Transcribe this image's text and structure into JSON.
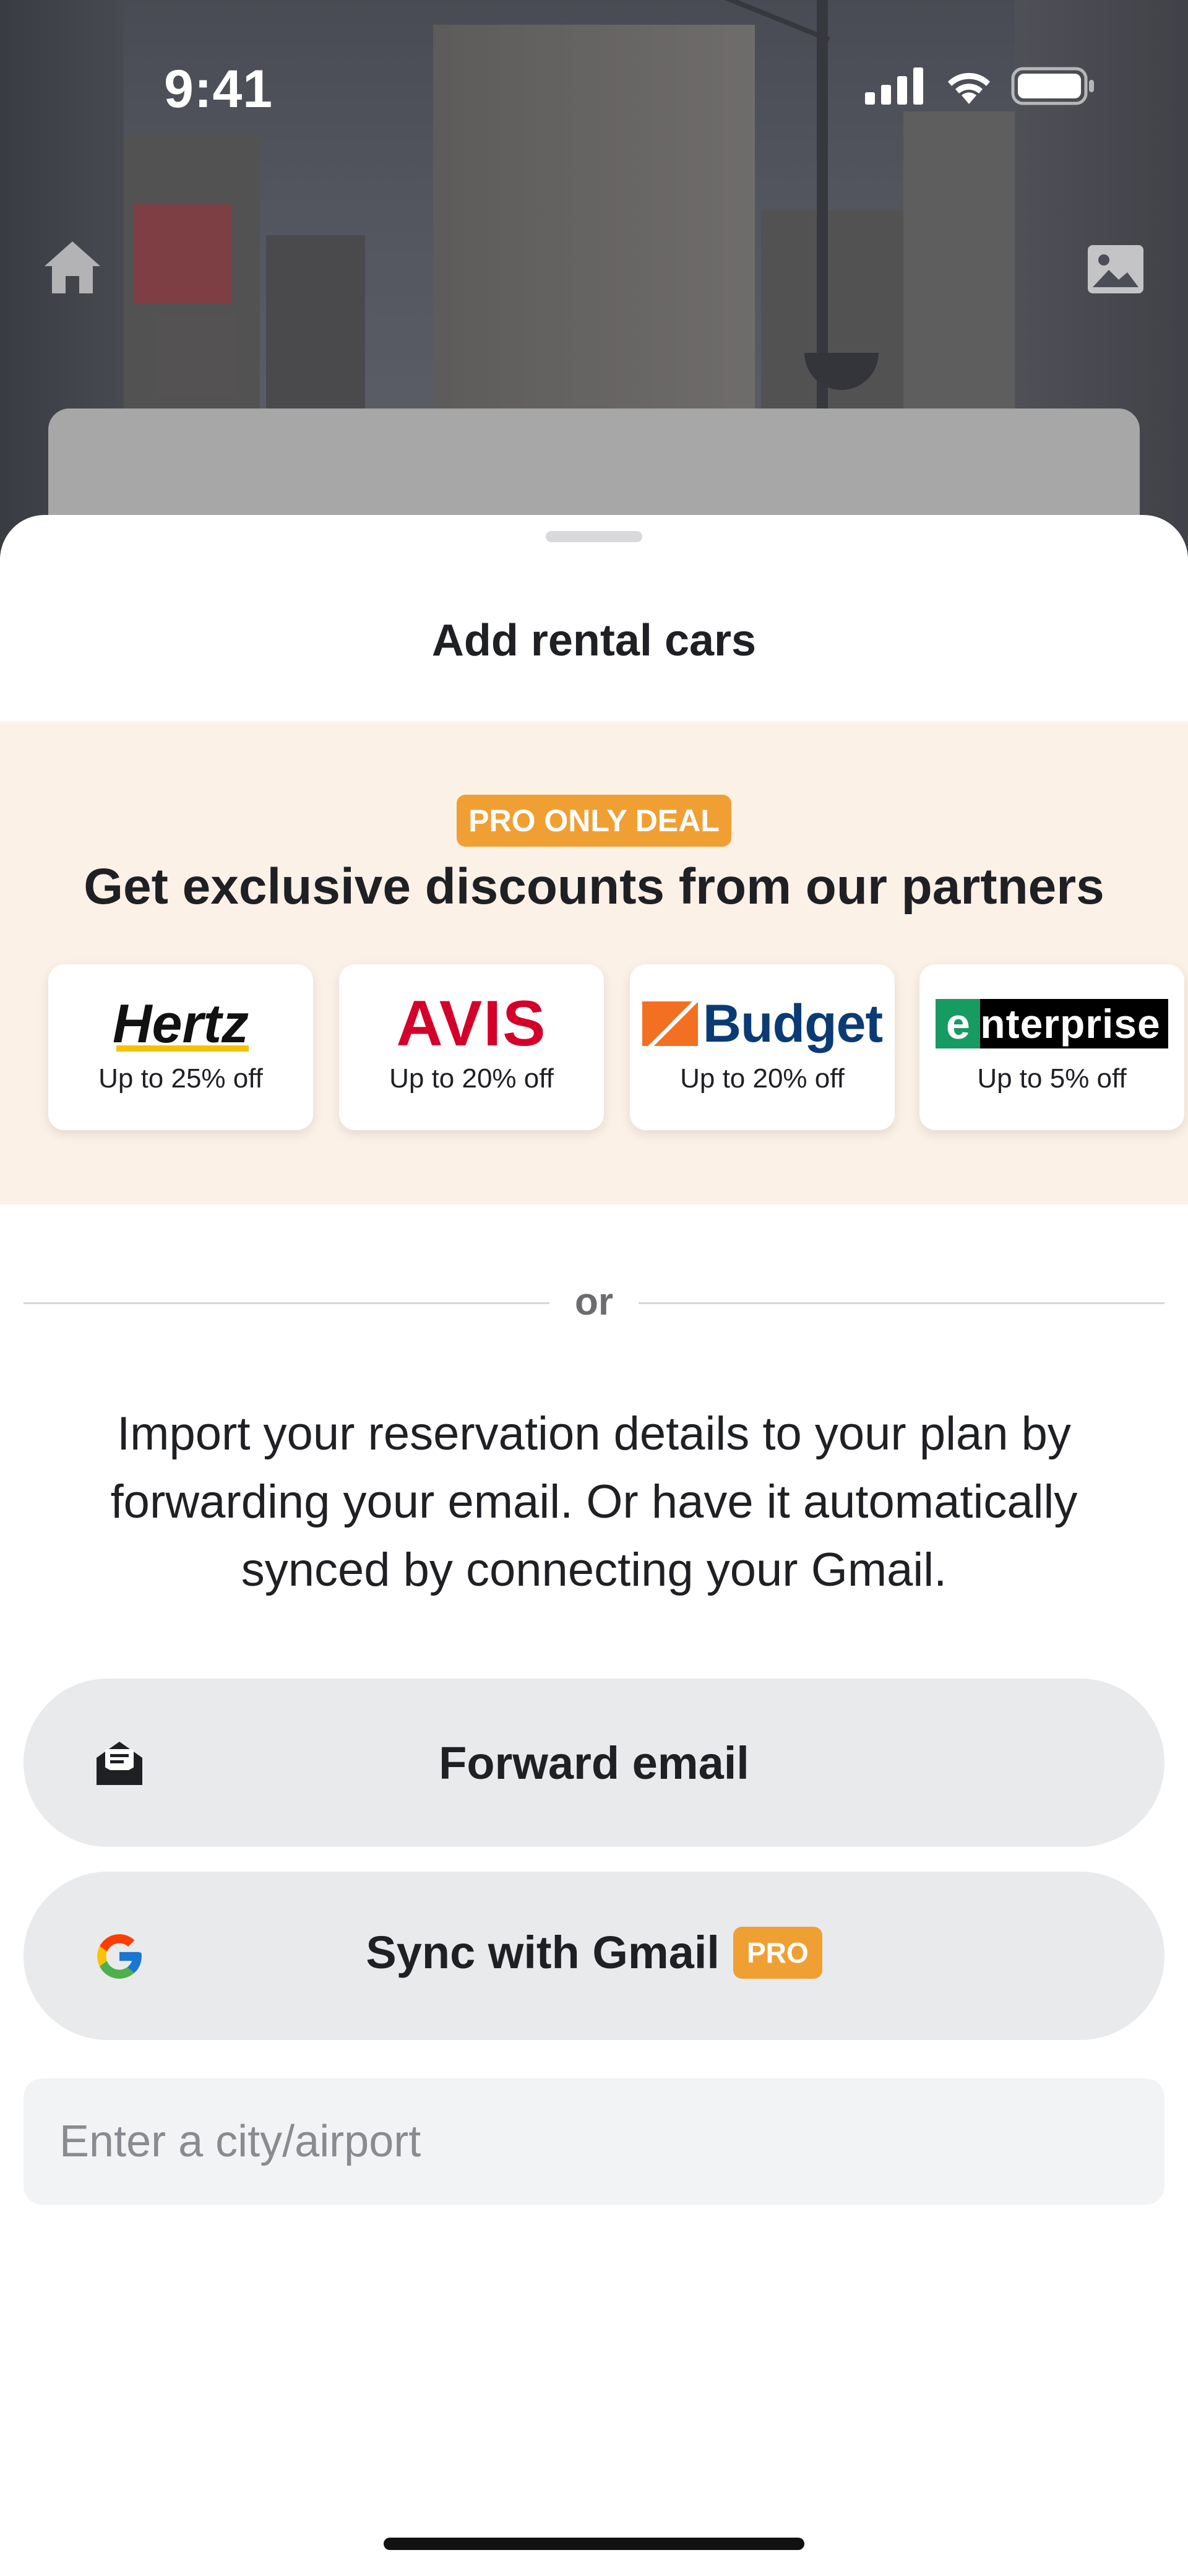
{
  "status_bar": {
    "time": "9:41"
  },
  "sheet": {
    "title": "Add rental cars"
  },
  "promo": {
    "badge": "PRO ONLY DEAL",
    "headline": "Get exclusive discounts from our partners",
    "partners": [
      {
        "logo_text": "Hertz",
        "offer": "Up to 25% off"
      },
      {
        "logo_text": "AVIS",
        "offer": "Up to 20% off"
      },
      {
        "logo_text": "Budget",
        "offer": "Up to 20% off"
      },
      {
        "logo_text": "enterprise",
        "offer": "Up to 5% off"
      }
    ]
  },
  "divider_label": "or",
  "import_text": "Import your reservation details to your plan by forwarding your email. Or have it automatically synced by connecting your Gmail.",
  "buttons": {
    "forward_email": "Forward email",
    "sync_gmail": "Sync with Gmail",
    "pro_badge": "PRO"
  },
  "search": {
    "placeholder": "Enter a city/airport",
    "value": ""
  },
  "icons": {
    "home": "home-icon",
    "image": "image-icon",
    "forward": "envelope-open-icon",
    "gmail": "google-icon"
  },
  "colors": {
    "accent": "#f0a033",
    "promo_bg": "#fcf1e7",
    "button_bg": "#e8eaec"
  }
}
